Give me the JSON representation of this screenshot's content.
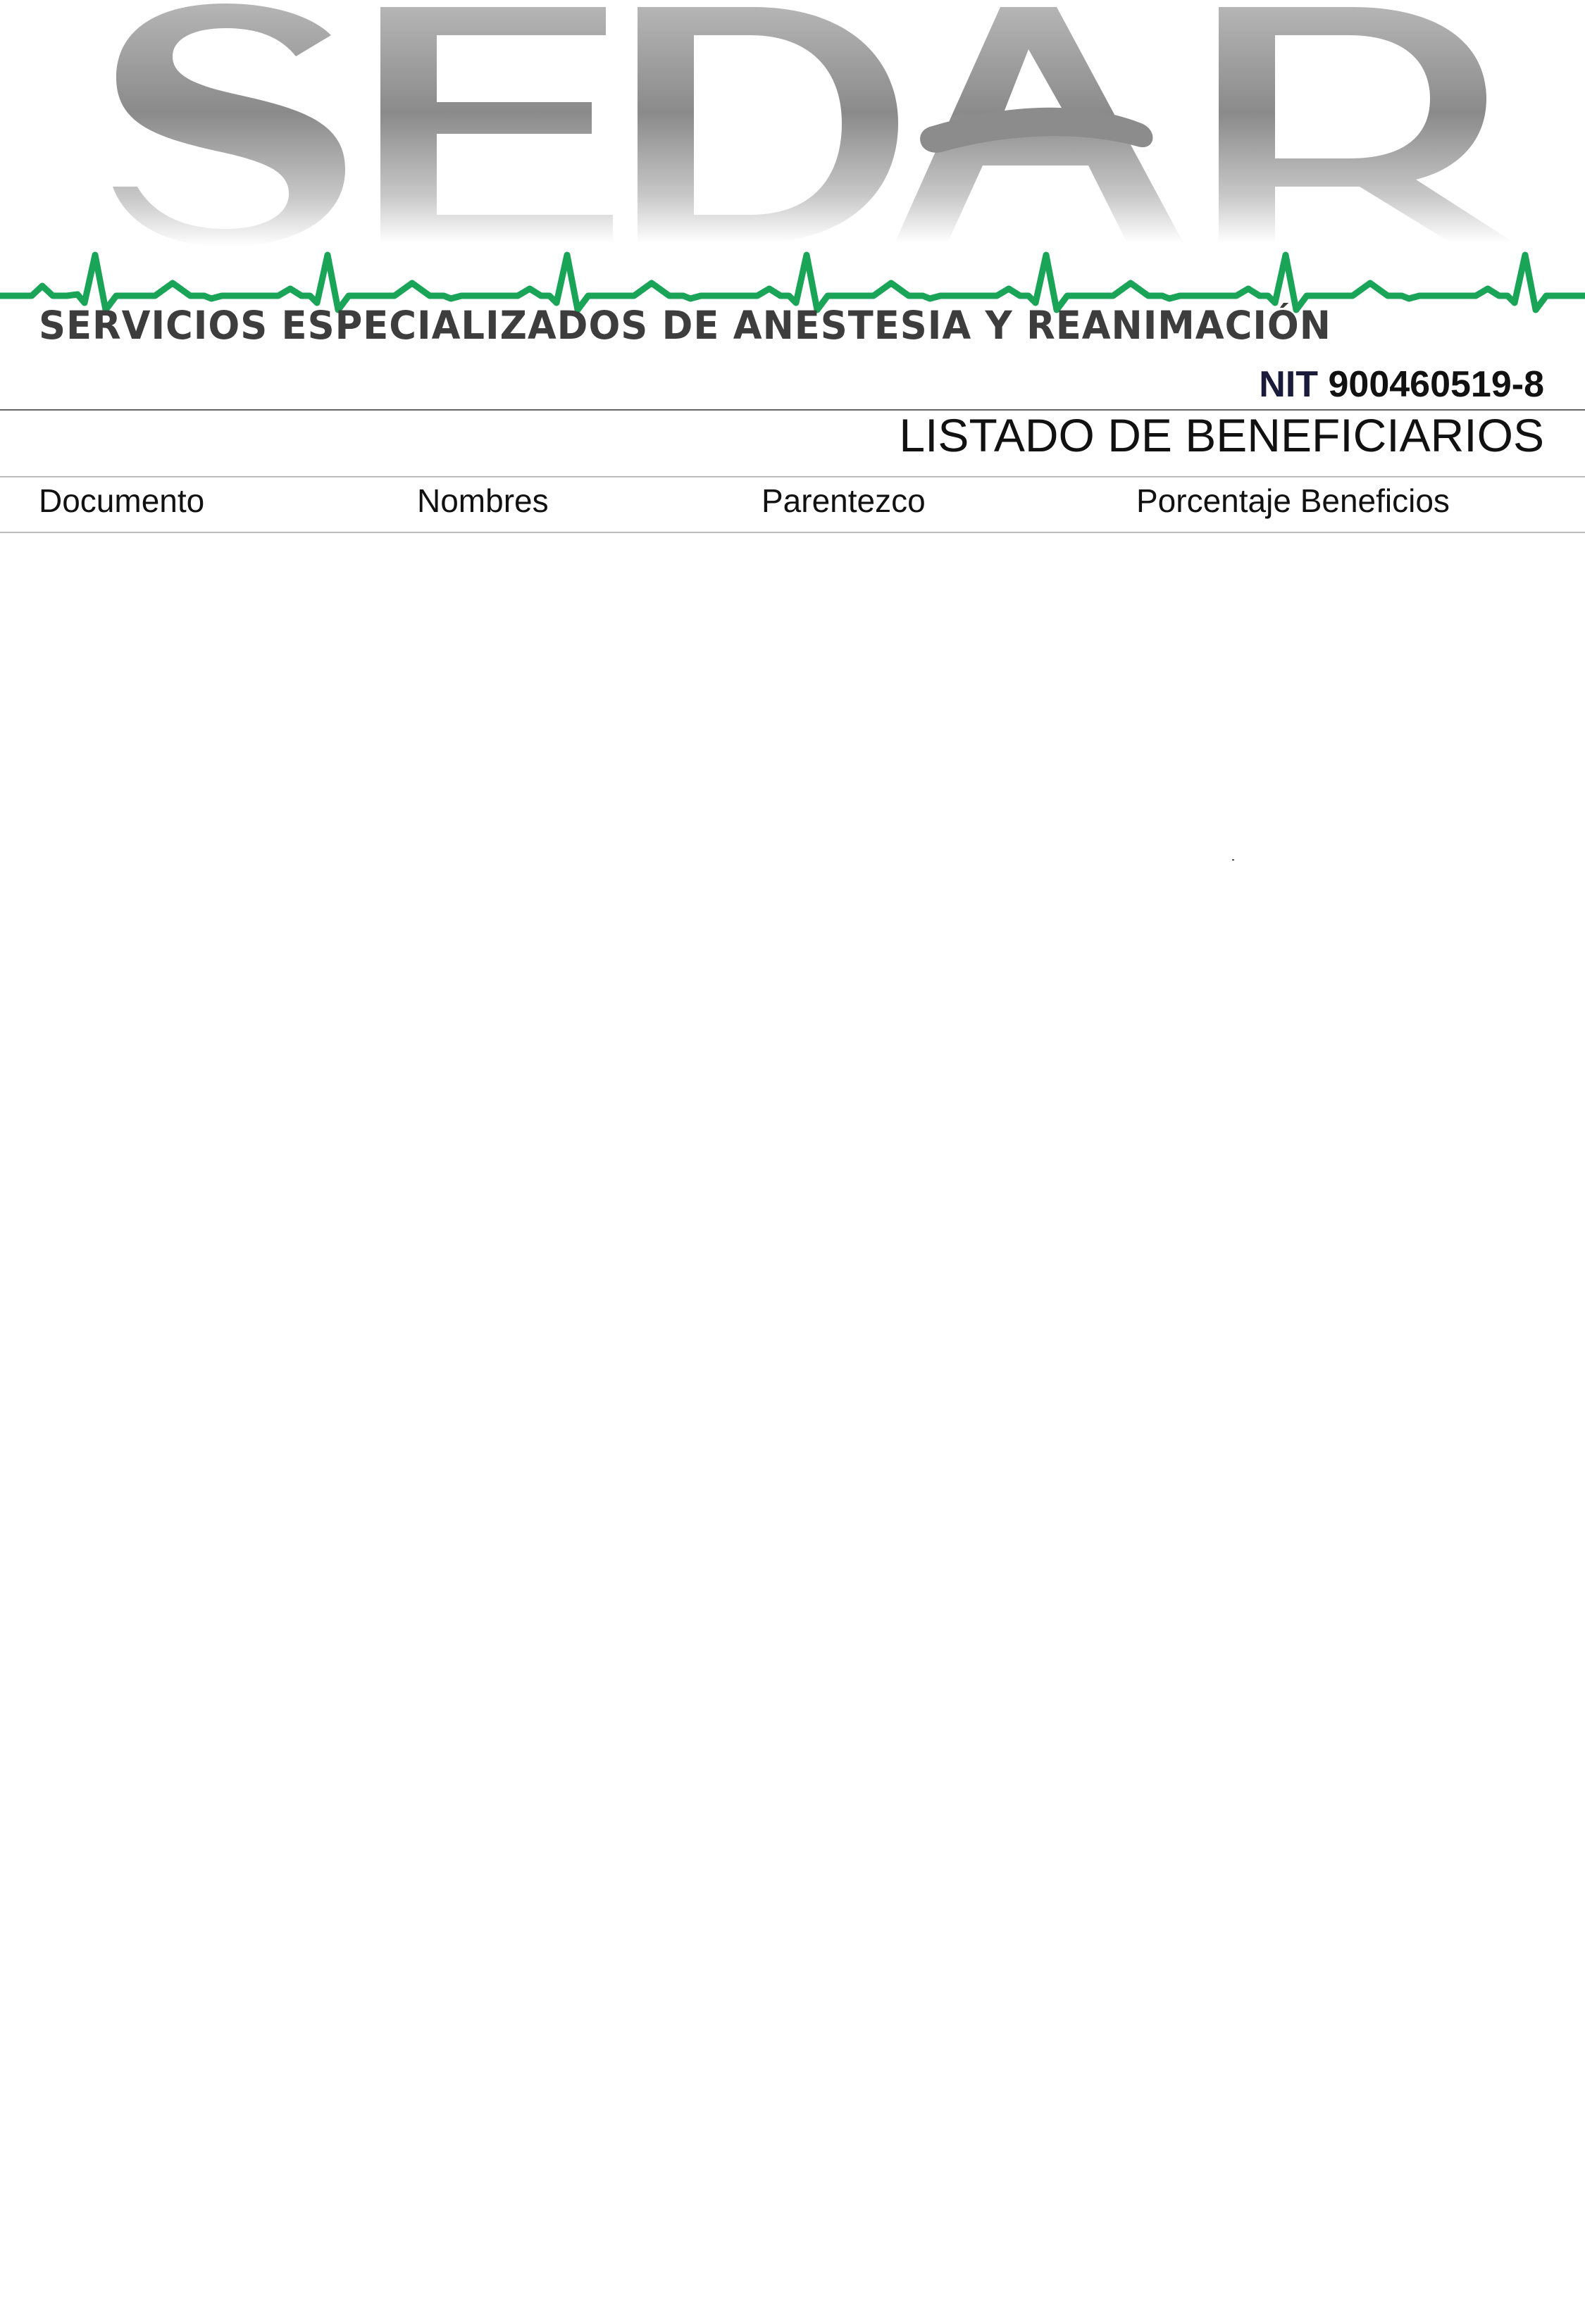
{
  "logo": {
    "wordmark": "SEDAR",
    "company_name": "SERVICIOS ESPECIALIZADOS DE ANESTESIA Y REANIMACIÓN",
    "ecg_color": "#1aa457",
    "letter_color": "#8c8c8c"
  },
  "nit": {
    "label": "NIT",
    "number": "900460519-8"
  },
  "document": {
    "title": "LISTADO DE BENEFICIARIOS"
  },
  "table": {
    "columns": [
      "Documento",
      "Nombres",
      "Parentezco",
      "Porcentaje Beneficios"
    ],
    "rows": []
  }
}
